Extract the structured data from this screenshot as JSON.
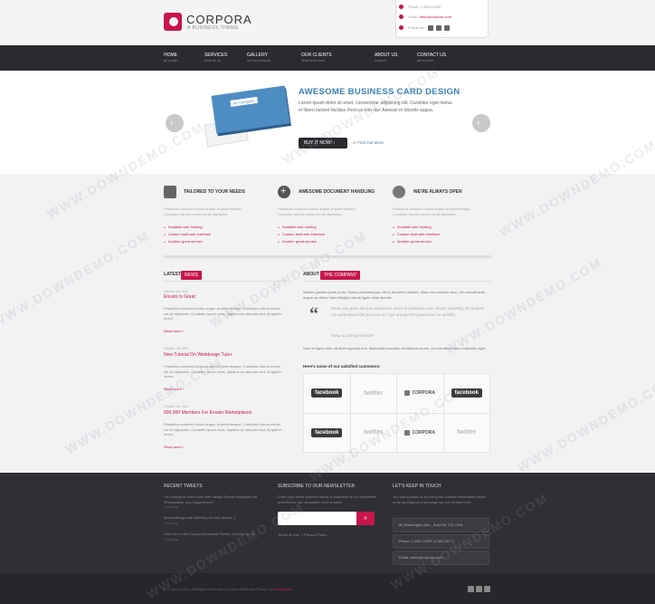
{
  "brand": {
    "name": "CORPORA",
    "tagline": "A BUSINESS THEME",
    "accent": "#c8154c"
  },
  "contact": {
    "phone": "Phone: 1-800-CORP",
    "email_label": "Email:",
    "email": "office@corpora.com",
    "follow": "Follow Us:"
  },
  "nav": [
    {
      "label": "HOME",
      "sub": "go to start"
    },
    {
      "label": "SERVICES",
      "sub": "what we do"
    },
    {
      "label": "GALLERY",
      "sub": "see our products"
    },
    {
      "label": "OUR CLIENTS",
      "sub": "what we've done"
    },
    {
      "label": "ABOUT US",
      "sub": "know us"
    },
    {
      "label": "CONTACT US",
      "sub": "get in touch"
    }
  ],
  "slider": {
    "title": "AWESOME BUSINESS CARD DESIGN",
    "text": "Lorem ipsum dolor sit amet, consectetur adipiscing elit. Curabitur eget metus et libero laoreet facilisis rhoncus non nisi. Aenean et lobortis augue.",
    "button": "BUY IT NOW!",
    "or": "or",
    "link": "Find Out More",
    "card_label": "My Company"
  },
  "features": [
    {
      "title": "TAILORED TO YOUR NEEDS",
      "text": "Phasellus euismod luctus augue at pellentesque. Curabitur rutrum metus vel sit dignissim.",
      "items": [
        "Scalable web hosting",
        "Custom built web interface",
        "Another great service"
      ]
    },
    {
      "title": "AWESOME DOCUMENT HANDLING",
      "text": "Phasellus euismod luctus augue at pellentesque. Curabitur rutrum metus vel sit dignissim.",
      "items": [
        "Scalable web hosting",
        "Custom built web interface",
        "Another great service"
      ]
    },
    {
      "title": "WE'RE ALWAYS OPEN",
      "text": "Phasellus euismod luctus augue at pellentesque. Curabitur rutrum metus vel sit dignissim.",
      "items": [
        "Scalable web hosting",
        "Custom built web interface",
        "Another great service"
      ]
    }
  ],
  "news": {
    "heading": "LATEST",
    "tag": "NEWS",
    "items": [
      {
        "date": "October 1st, 2011",
        "title": "Envato Is Great",
        "text": "Phasellus euismod luctus augue at pellentesque. Curabitur rutrum metus vel sit dignissim. Curabitur ipsum eros, dapibus eu aliquam sed, feugiat in lorem.",
        "more": "Read more"
      },
      {
        "date": "October 1st, 2011",
        "title": "New Tutorial On Webdesign Tuts+",
        "text": "Phasellus euismod luctus augue at pellentesque. Curabitur rutrum metus vel sit dignissim. Curabitur ipsum eros, dapibus eu aliquam sed, feugiat in lorem.",
        "more": "Read more"
      },
      {
        "date": "October 1st, 2011",
        "title": "600,000 Members For Envato Marketplaces",
        "text": "Phasellus euismod luctus augue at pellentesque. Curabitur rutrum metus vel sit dignissim. Curabitur ipsum eros, dapibus eu aliquam sed, feugiat in lorem.",
        "more": "Read more"
      }
    ]
  },
  "about": {
    "heading": "ABOUT",
    "tag": "THE COMPANY",
    "text1": "Nullam gravida porta porta. Mauris pellentesque, elit in hendrerit ultrices, diam nisl euismod arcu, nec blandit ante augue ac tellus. Nam fringilla rutrum ligula vitae laoreet.",
    "quote": "Wow, you guys are just awesome. Dave in particular was simply amazing, he helped me understand the process so I got around the paperwork so quickly.",
    "quote_by": "Keep up the good work!",
    "text2": "Nam et ligula felis, sit amet egestas orci. Maecenas faucibus elementum purus, sed hendrerit nunc vulputate eget.",
    "customers_label": "Here's some of our satisfied customers:",
    "logos": [
      "facebook",
      "twitter",
      "corpora",
      "facebook",
      "facebook",
      "twitter",
      "corpora",
      "twitter"
    ]
  },
  "footer": {
    "tweets_title": "RECENT TWEETS",
    "tweets": [
      {
        "text": "I'm looking for some cool web design Envato templates for Wholesalers, any suggestions?",
        "time": "2 days ago"
      },
      {
        "text": "@wellsdesign will definitely do that, thanks :)",
        "time": "2 days ago"
      },
      {
        "text": "How cool is the Corpora Business Theme. Having fun :D",
        "time": "2 days ago"
      }
    ],
    "newsletter_title": "SUBSCRIBE TO OUR NEWSLETTER",
    "newsletter_text": "Enter your email address below to subscribe to our newsletter and receive our newsletter once a week.",
    "newsletter_button": "»",
    "terms": "Terms of Use",
    "privacy": "Privacy Policy",
    "touch_title": "LET'S KEEP IN TOUCH",
    "touch_text": "You can contact us by using the contact information below or by sending us a message via our contact form.",
    "address": "80 Washington Ave., Suite 50, CA, USA",
    "phone": "Phone: 1-800-CORP (1-800-2677)",
    "email": "Email: office@corpora.com"
  },
  "copyright": {
    "text": "© Corpora 2011. All Rights Reserved. Premium Business Theme by",
    "author": "OrangeIdea"
  }
}
